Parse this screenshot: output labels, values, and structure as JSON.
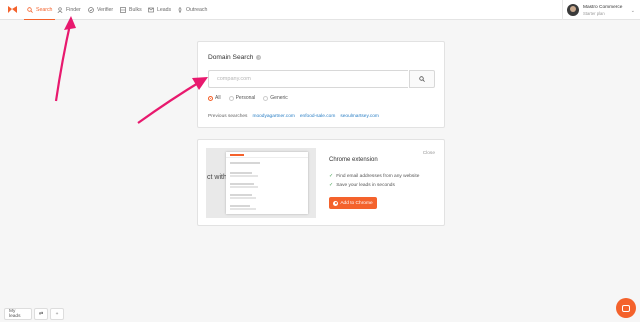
{
  "nav": {
    "items": [
      {
        "label": "Search",
        "icon": "search-icon",
        "active": true
      },
      {
        "label": "Finder",
        "icon": "person-icon",
        "active": false
      },
      {
        "label": "Verifier",
        "icon": "check-circle-icon",
        "active": false
      },
      {
        "label": "Bulks",
        "icon": "grid-icon",
        "active": false
      },
      {
        "label": "Leads",
        "icon": "leads-icon",
        "active": false
      },
      {
        "label": "Outreach",
        "icon": "outreach-icon",
        "active": false
      }
    ],
    "accent": "#f4622c"
  },
  "user": {
    "name": "Mastro Commerce",
    "plan": "Starter plan"
  },
  "domain_search": {
    "title": "Domain Search",
    "placeholder": "company.com",
    "filters": [
      {
        "label": "All",
        "selected": true
      },
      {
        "label": "Personal",
        "selected": false
      },
      {
        "label": "Generic",
        "selected": false
      }
    ],
    "previous_label": "Previous searches",
    "previous": [
      "moodyagartner.com",
      "enfood-sale.com",
      "seoulmartsey.com"
    ]
  },
  "extension": {
    "title": "Chrome extension",
    "close_label": "Close",
    "features": [
      "Find email addresses from any website",
      "Save your leads in seconds"
    ],
    "button_label": "Add to Chrome",
    "preview_text": "ct with"
  },
  "bottom": {
    "my_leads": "My leads"
  }
}
